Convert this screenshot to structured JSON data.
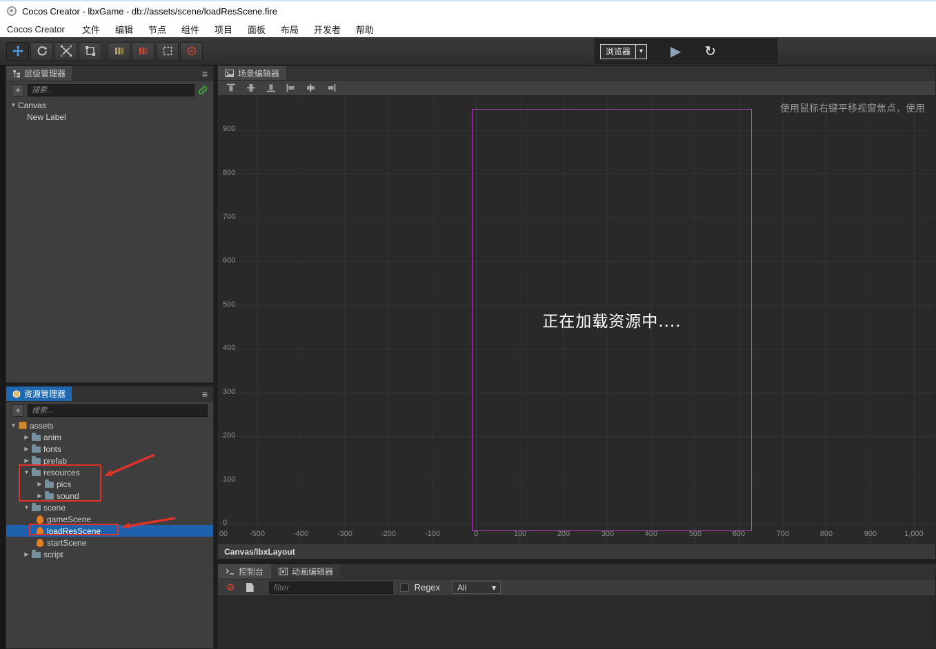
{
  "window": {
    "title": "Cocos Creator - lbxGame - db://assets/scene/loadResScene.fire"
  },
  "menubar": {
    "app_label": "Cocos Creator",
    "items": [
      "文件",
      "编辑",
      "节点",
      "组件",
      "项目",
      "面板",
      "布局",
      "开发者",
      "帮助"
    ]
  },
  "toolbar": {
    "browser_dropdown": "浏览器"
  },
  "hierarchy": {
    "tab": "层级管理器",
    "add_button": "+",
    "search_placeholder": "搜索...",
    "nodes": [
      {
        "label": "Canvas",
        "state": "expanded"
      },
      {
        "label": "New Label"
      }
    ]
  },
  "assets": {
    "tab": "资源管理器",
    "add_button": "+",
    "search_placeholder": "搜索...",
    "items": [
      {
        "label": "assets",
        "type": "root",
        "state": "expanded"
      },
      {
        "label": "anim",
        "type": "folder",
        "state": "collapsed"
      },
      {
        "label": "fonts",
        "type": "folder",
        "state": "collapsed"
      },
      {
        "label": "prefab",
        "type": "folder",
        "state": "collapsed"
      },
      {
        "label": "resources",
        "type": "folder",
        "state": "expanded"
      },
      {
        "label": "pics",
        "type": "folder",
        "state": "collapsed"
      },
      {
        "label": "sound",
        "type": "folder",
        "state": "collapsed"
      },
      {
        "label": "scene",
        "type": "folder",
        "state": "expanded"
      },
      {
        "label": "gameScene",
        "type": "scene-file"
      },
      {
        "label": "loadResScene",
        "type": "scene-file",
        "selected": true
      },
      {
        "label": "startScene",
        "type": "scene-file"
      },
      {
        "label": "script",
        "type": "folder",
        "state": "collapsed"
      }
    ]
  },
  "scene": {
    "tab": "场景编辑器",
    "hint": "使用鼠标右键平移视窗焦点，使用",
    "loading_text": "正在加载资源中....",
    "breadcrumb": "Canvas/lbxLayout",
    "design_border_color": "#c341c3",
    "ruler_y": [
      "900",
      "800",
      "700",
      "600",
      "500",
      "400",
      "300",
      "200",
      "100",
      "0"
    ],
    "ruler_x": [
      "00",
      "-500",
      "-400",
      "-300",
      "-200",
      "-100",
      "0",
      "100",
      "200",
      "300",
      "400",
      "500",
      "600",
      "700",
      "800",
      "900",
      "1,000"
    ]
  },
  "console": {
    "tab_console": "控制台",
    "tab_animation": "动画编辑器",
    "filter_placeholder": "filter",
    "regex_label": "Regex",
    "type_filter": "All"
  }
}
